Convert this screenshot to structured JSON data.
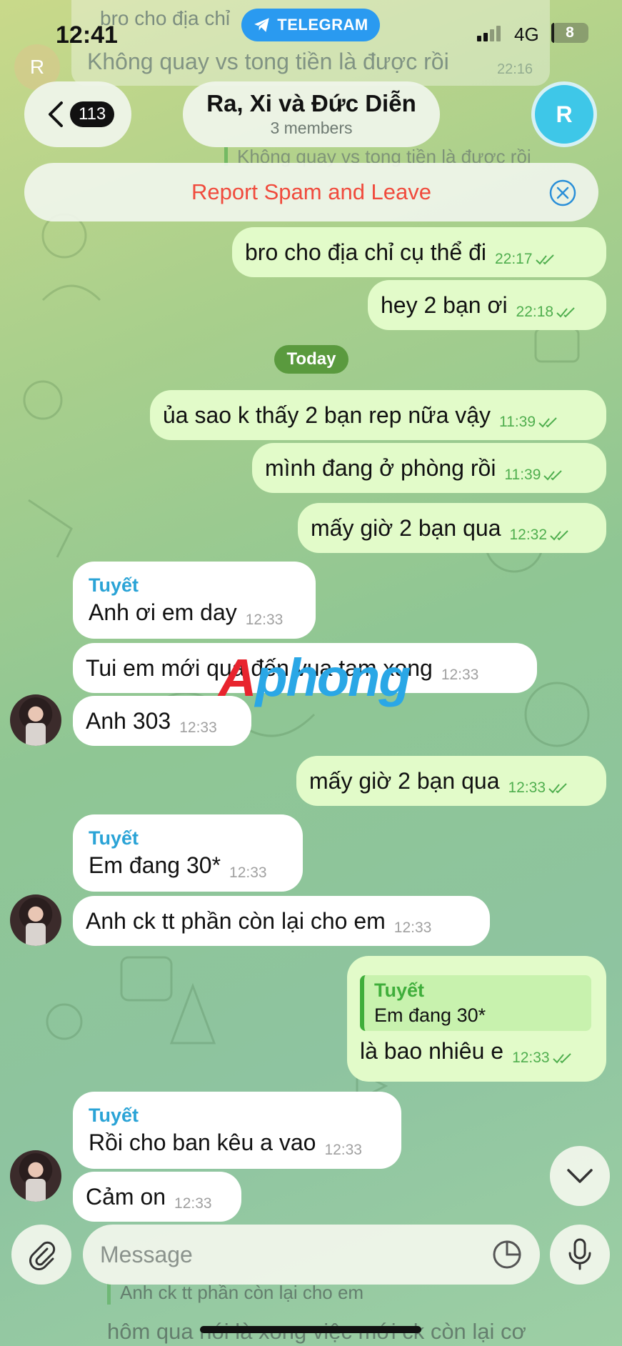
{
  "status_bar": {
    "time": "12:41",
    "app_pill": "TELEGRAM",
    "network": "4G",
    "battery": "8",
    "battery_fraction": 0.08
  },
  "ghost_top": {
    "line1": "bro cho địa chỉ",
    "line2": "Không quay vs tong tiền là được rồi",
    "time": "22:16",
    "avatar_letter": "R"
  },
  "header": {
    "unread_count": "113",
    "title": "Ra, Xi và Đức Diễn",
    "subtitle": "3 members",
    "avatar_letter": "R"
  },
  "ghost_reply_strip": "Không quay vs tong tiền là được rồi",
  "report_bar": {
    "label": "Report Spam and Leave"
  },
  "date_divider": "Today",
  "messages": [
    {
      "dir": "out",
      "text": "bro cho địa chỉ cụ thể đi",
      "time": "22:17"
    },
    {
      "dir": "out",
      "text": "hey 2 bạn ơi",
      "time": "22:18"
    },
    {
      "dir": "out",
      "text": "ủa sao k thấy 2 bạn rep nữa vậy",
      "time": "11:39"
    },
    {
      "dir": "out",
      "text": "mình đang ở phòng rồi",
      "time": "11:39"
    },
    {
      "dir": "out",
      "text": "mấy giờ 2 bạn qua",
      "time": "12:32"
    },
    {
      "dir": "in",
      "sender": "Tuyết",
      "text": "Anh ơi em day",
      "time": "12:33"
    },
    {
      "dir": "in",
      "text": "Tui em mới qua đến vua tam xong",
      "time": "12:33"
    },
    {
      "dir": "in",
      "text": "Anh 303",
      "time": "12:33"
    },
    {
      "dir": "out",
      "text": "mấy giờ 2 bạn qua",
      "time": "12:33"
    },
    {
      "dir": "in",
      "sender": "Tuyết",
      "text": "Em đang 30*",
      "time": "12:33"
    },
    {
      "dir": "in",
      "text": "Anh ck tt phần còn lại cho em",
      "time": "12:33"
    },
    {
      "dir": "out",
      "reply_name": "Tuyết",
      "reply_text": "Em đang 30*",
      "text": "là bao nhiêu e",
      "time": "12:33"
    },
    {
      "dir": "in",
      "sender": "Tuyết",
      "text": "Rồi cho ban kêu a vao",
      "time": "12:33"
    },
    {
      "dir": "in",
      "text": "Cảm on",
      "time": "12:33"
    }
  ],
  "composer": {
    "placeholder": "Message"
  },
  "ghost_bottom": {
    "reply_text": "Anh ck tt phần còn lại cho em",
    "line": "hôm qua nói là xong việc mới ck còn lại cơ"
  },
  "watermark": {
    "part1": "A",
    "part2": "phong"
  },
  "icons": [
    "telegram-icon",
    "back-chevron-icon",
    "close-circle-icon",
    "double-check-icon",
    "chevron-down-icon",
    "paperclip-icon",
    "sticker-icon",
    "microphone-icon"
  ],
  "colors": {
    "accent": "#2a9af0",
    "out_bubble": "#e2fbc9",
    "in_bubble": "#ffffff",
    "check": "#4fae4e",
    "report": "#f04a3c",
    "sender": "#2aa3d6"
  }
}
